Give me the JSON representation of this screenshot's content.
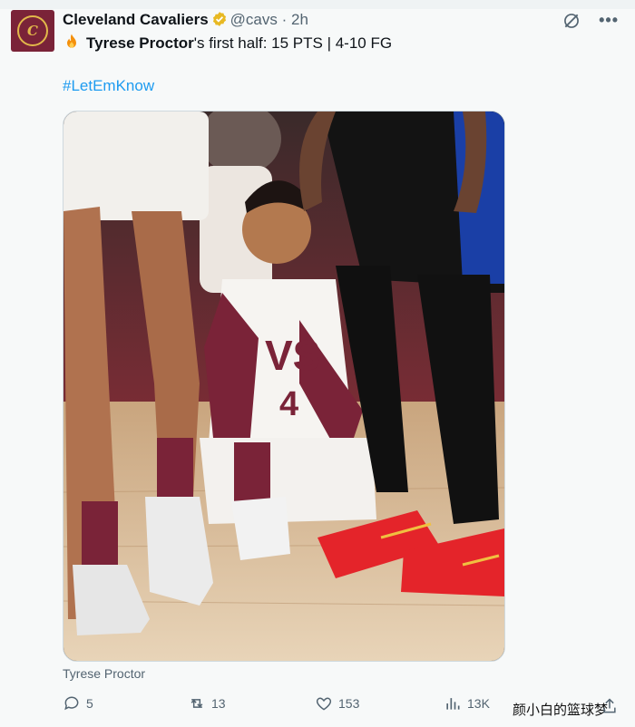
{
  "account": {
    "name": "Cleveland Cavaliers",
    "handle": "@cavs",
    "separator": "·",
    "time": "2h",
    "avatar_letter": "C"
  },
  "tweet": {
    "player_name": "Tyrese Proctor",
    "stat_text": "'s first half: 15 PTS | 4-10 FG",
    "hashtag": "#LetEmKnow"
  },
  "media": {
    "caption": "Tyrese Proctor"
  },
  "actions": {
    "replies": "5",
    "reposts": "13",
    "likes": "153",
    "views": "13K"
  },
  "watermark": "颜小白的篮球梦",
  "colors": {
    "link": "#1d9bf0",
    "avatar_bg": "#7a2338",
    "avatar_accent": "#e2b84a",
    "muted": "#536471"
  }
}
